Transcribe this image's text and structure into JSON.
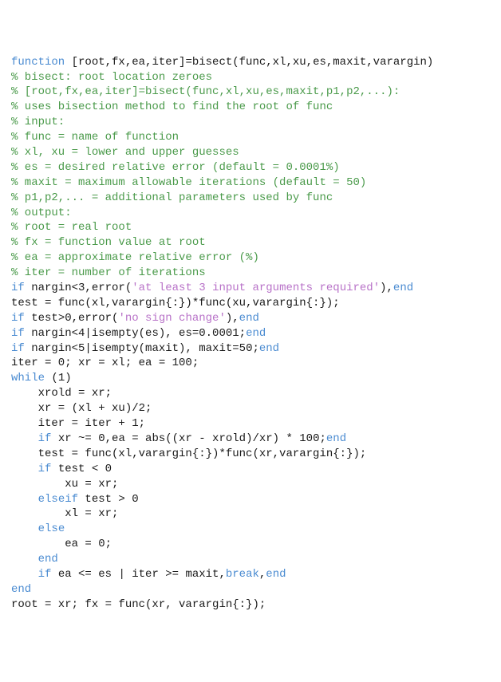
{
  "code": {
    "lines": [
      {
        "parts": [
          {
            "t": "function ",
            "c": "kw"
          },
          {
            "t": "[root,fx,ea,iter]=bisect(func,xl,xu,es,maxit,varargin)",
            "c": ""
          }
        ]
      },
      {
        "parts": [
          {
            "t": "% bisect: root location zeroes",
            "c": "com"
          }
        ]
      },
      {
        "parts": [
          {
            "t": "% [root,fx,ea,iter]=bisect(func,xl,xu,es,maxit,p1,p2,...):",
            "c": "com"
          }
        ]
      },
      {
        "parts": [
          {
            "t": "% uses bisection method to find the root of func",
            "c": "com"
          }
        ]
      },
      {
        "parts": [
          {
            "t": "% input:",
            "c": "com"
          }
        ]
      },
      {
        "parts": [
          {
            "t": "% func = name of function",
            "c": "com"
          }
        ]
      },
      {
        "parts": [
          {
            "t": "% xl, xu = lower and upper guesses",
            "c": "com"
          }
        ]
      },
      {
        "parts": [
          {
            "t": "% es = desired relative error (default = 0.0001%)",
            "c": "com"
          }
        ]
      },
      {
        "parts": [
          {
            "t": "% maxit = maximum allowable iterations (default = 50)",
            "c": "com"
          }
        ]
      },
      {
        "parts": [
          {
            "t": "% p1,p2,... = additional parameters used by func",
            "c": "com"
          }
        ]
      },
      {
        "parts": [
          {
            "t": "% output:",
            "c": "com"
          }
        ]
      },
      {
        "parts": [
          {
            "t": "% root = real root",
            "c": "com"
          }
        ]
      },
      {
        "parts": [
          {
            "t": "% fx = function value at root",
            "c": "com"
          }
        ]
      },
      {
        "parts": [
          {
            "t": "% ea = approximate relative error (%)",
            "c": "com"
          }
        ]
      },
      {
        "parts": [
          {
            "t": "% iter = number of iterations",
            "c": "com"
          }
        ]
      },
      {
        "parts": [
          {
            "t": "if ",
            "c": "kw"
          },
          {
            "t": "nargin<3,error(",
            "c": ""
          },
          {
            "t": "'at least 3 input arguments required'",
            "c": "str"
          },
          {
            "t": "),",
            "c": ""
          },
          {
            "t": "end",
            "c": "kw"
          }
        ]
      },
      {
        "parts": [
          {
            "t": "test = func(xl,varargin{:})*func(xu,varargin{:});",
            "c": ""
          }
        ]
      },
      {
        "parts": [
          {
            "t": "if ",
            "c": "kw"
          },
          {
            "t": "test>0,error(",
            "c": ""
          },
          {
            "t": "'no sign change'",
            "c": "str"
          },
          {
            "t": "),",
            "c": ""
          },
          {
            "t": "end",
            "c": "kw"
          }
        ]
      },
      {
        "parts": [
          {
            "t": "if ",
            "c": "kw"
          },
          {
            "t": "nargin<4|isempty(es), es=0.0001;",
            "c": ""
          },
          {
            "t": "end",
            "c": "kw"
          }
        ]
      },
      {
        "parts": [
          {
            "t": "if ",
            "c": "kw"
          },
          {
            "t": "nargin<5|isempty(maxit), maxit=50;",
            "c": ""
          },
          {
            "t": "end",
            "c": "kw"
          }
        ]
      },
      {
        "parts": [
          {
            "t": "iter = 0; xr = xl; ea = 100;",
            "c": ""
          }
        ]
      },
      {
        "parts": [
          {
            "t": "while ",
            "c": "kw"
          },
          {
            "t": "(1)",
            "c": ""
          }
        ]
      },
      {
        "parts": [
          {
            "t": "    xrold = xr;",
            "c": ""
          }
        ]
      },
      {
        "parts": [
          {
            "t": "    xr = (xl + xu)/2;",
            "c": ""
          }
        ]
      },
      {
        "parts": [
          {
            "t": "    iter = iter + 1;",
            "c": ""
          }
        ]
      },
      {
        "parts": [
          {
            "t": "    ",
            "c": ""
          },
          {
            "t": "if ",
            "c": "kw"
          },
          {
            "t": "xr ~= 0,ea = abs((xr - xrold)/xr) * 100;",
            "c": ""
          },
          {
            "t": "end",
            "c": "kw"
          }
        ]
      },
      {
        "parts": [
          {
            "t": "    test = func(xl,varargin{:})*func(xr,varargin{:});",
            "c": ""
          }
        ]
      },
      {
        "parts": [
          {
            "t": "    ",
            "c": ""
          },
          {
            "t": "if ",
            "c": "kw"
          },
          {
            "t": "test < 0",
            "c": ""
          }
        ]
      },
      {
        "parts": [
          {
            "t": "        xu = xr;",
            "c": ""
          }
        ]
      },
      {
        "parts": [
          {
            "t": "    ",
            "c": ""
          },
          {
            "t": "elseif ",
            "c": "kw"
          },
          {
            "t": "test > 0",
            "c": ""
          }
        ]
      },
      {
        "parts": [
          {
            "t": "        xl = xr;",
            "c": ""
          }
        ]
      },
      {
        "parts": [
          {
            "t": "    ",
            "c": ""
          },
          {
            "t": "else",
            "c": "kw"
          }
        ]
      },
      {
        "parts": [
          {
            "t": "        ea = 0;",
            "c": ""
          }
        ]
      },
      {
        "parts": [
          {
            "t": "    ",
            "c": ""
          },
          {
            "t": "end",
            "c": "kw"
          }
        ]
      },
      {
        "parts": [
          {
            "t": "    ",
            "c": ""
          },
          {
            "t": "if ",
            "c": "kw"
          },
          {
            "t": "ea <= es | iter >= maxit,",
            "c": ""
          },
          {
            "t": "break",
            "c": "kw"
          },
          {
            "t": ",",
            "c": ""
          },
          {
            "t": "end",
            "c": "kw"
          }
        ]
      },
      {
        "parts": [
          {
            "t": "end",
            "c": "kw"
          }
        ]
      },
      {
        "parts": [
          {
            "t": "root = xr; fx = func(xr, varargin{:});",
            "c": ""
          }
        ]
      }
    ]
  }
}
